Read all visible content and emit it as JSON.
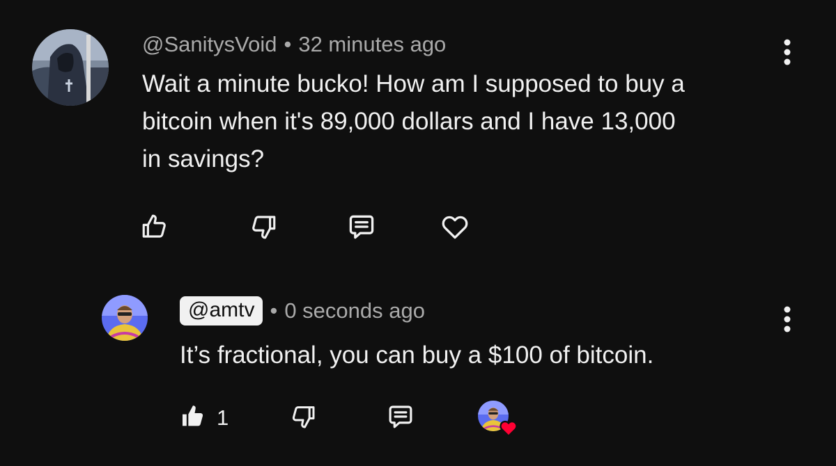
{
  "comment": {
    "author": "@SanitysVoid",
    "separator": "•",
    "time": "32 minutes ago",
    "text_lines": [
      "Wait a minute bucko! How am I supposed to buy a",
      "bitcoin when it's 89,000 dollars and I have 13,000",
      "in savings?"
    ],
    "icons": {
      "like": "thumbs-up-icon",
      "dislike": "thumbs-down-icon",
      "reply": "reply-icon",
      "heart": "heart-icon",
      "menu": "more-vert-icon"
    }
  },
  "reply": {
    "author": "@amtv",
    "separator": "•",
    "time": "0 seconds ago",
    "text": "It’s fractional, you can buy a $100 of bitcoin.",
    "like_count": "1",
    "icons": {
      "like": "thumbs-up-filled-icon",
      "dislike": "thumbs-down-icon",
      "reply": "reply-icon",
      "creator_heart": "creator-heart-icon",
      "menu": "more-vert-icon"
    }
  },
  "colors": {
    "background": "#0f0f0f",
    "text_primary": "#f1f1f1",
    "text_secondary": "#aaaaaa",
    "heart_red": "#ff0033",
    "badge_background": "#f1f1f1"
  }
}
